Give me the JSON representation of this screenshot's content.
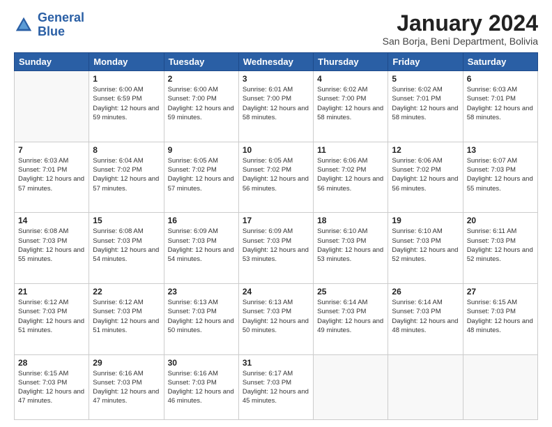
{
  "logo": {
    "line1": "General",
    "line2": "Blue"
  },
  "title": "January 2024",
  "subtitle": "San Borja, Beni Department, Bolivia",
  "weekdays": [
    "Sunday",
    "Monday",
    "Tuesday",
    "Wednesday",
    "Thursday",
    "Friday",
    "Saturday"
  ],
  "weeks": [
    [
      {
        "day": "",
        "sunrise": "",
        "sunset": "",
        "daylight": ""
      },
      {
        "day": "1",
        "sunrise": "Sunrise: 6:00 AM",
        "sunset": "Sunset: 6:59 PM",
        "daylight": "Daylight: 12 hours and 59 minutes."
      },
      {
        "day": "2",
        "sunrise": "Sunrise: 6:00 AM",
        "sunset": "Sunset: 7:00 PM",
        "daylight": "Daylight: 12 hours and 59 minutes."
      },
      {
        "day": "3",
        "sunrise": "Sunrise: 6:01 AM",
        "sunset": "Sunset: 7:00 PM",
        "daylight": "Daylight: 12 hours and 58 minutes."
      },
      {
        "day": "4",
        "sunrise": "Sunrise: 6:02 AM",
        "sunset": "Sunset: 7:00 PM",
        "daylight": "Daylight: 12 hours and 58 minutes."
      },
      {
        "day": "5",
        "sunrise": "Sunrise: 6:02 AM",
        "sunset": "Sunset: 7:01 PM",
        "daylight": "Daylight: 12 hours and 58 minutes."
      },
      {
        "day": "6",
        "sunrise": "Sunrise: 6:03 AM",
        "sunset": "Sunset: 7:01 PM",
        "daylight": "Daylight: 12 hours and 58 minutes."
      }
    ],
    [
      {
        "day": "7",
        "sunrise": "Sunrise: 6:03 AM",
        "sunset": "Sunset: 7:01 PM",
        "daylight": "Daylight: 12 hours and 57 minutes."
      },
      {
        "day": "8",
        "sunrise": "Sunrise: 6:04 AM",
        "sunset": "Sunset: 7:02 PM",
        "daylight": "Daylight: 12 hours and 57 minutes."
      },
      {
        "day": "9",
        "sunrise": "Sunrise: 6:05 AM",
        "sunset": "Sunset: 7:02 PM",
        "daylight": "Daylight: 12 hours and 57 minutes."
      },
      {
        "day": "10",
        "sunrise": "Sunrise: 6:05 AM",
        "sunset": "Sunset: 7:02 PM",
        "daylight": "Daylight: 12 hours and 56 minutes."
      },
      {
        "day": "11",
        "sunrise": "Sunrise: 6:06 AM",
        "sunset": "Sunset: 7:02 PM",
        "daylight": "Daylight: 12 hours and 56 minutes."
      },
      {
        "day": "12",
        "sunrise": "Sunrise: 6:06 AM",
        "sunset": "Sunset: 7:02 PM",
        "daylight": "Daylight: 12 hours and 56 minutes."
      },
      {
        "day": "13",
        "sunrise": "Sunrise: 6:07 AM",
        "sunset": "Sunset: 7:03 PM",
        "daylight": "Daylight: 12 hours and 55 minutes."
      }
    ],
    [
      {
        "day": "14",
        "sunrise": "Sunrise: 6:08 AM",
        "sunset": "Sunset: 7:03 PM",
        "daylight": "Daylight: 12 hours and 55 minutes."
      },
      {
        "day": "15",
        "sunrise": "Sunrise: 6:08 AM",
        "sunset": "Sunset: 7:03 PM",
        "daylight": "Daylight: 12 hours and 54 minutes."
      },
      {
        "day": "16",
        "sunrise": "Sunrise: 6:09 AM",
        "sunset": "Sunset: 7:03 PM",
        "daylight": "Daylight: 12 hours and 54 minutes."
      },
      {
        "day": "17",
        "sunrise": "Sunrise: 6:09 AM",
        "sunset": "Sunset: 7:03 PM",
        "daylight": "Daylight: 12 hours and 53 minutes."
      },
      {
        "day": "18",
        "sunrise": "Sunrise: 6:10 AM",
        "sunset": "Sunset: 7:03 PM",
        "daylight": "Daylight: 12 hours and 53 minutes."
      },
      {
        "day": "19",
        "sunrise": "Sunrise: 6:10 AM",
        "sunset": "Sunset: 7:03 PM",
        "daylight": "Daylight: 12 hours and 52 minutes."
      },
      {
        "day": "20",
        "sunrise": "Sunrise: 6:11 AM",
        "sunset": "Sunset: 7:03 PM",
        "daylight": "Daylight: 12 hours and 52 minutes."
      }
    ],
    [
      {
        "day": "21",
        "sunrise": "Sunrise: 6:12 AM",
        "sunset": "Sunset: 7:03 PM",
        "daylight": "Daylight: 12 hours and 51 minutes."
      },
      {
        "day": "22",
        "sunrise": "Sunrise: 6:12 AM",
        "sunset": "Sunset: 7:03 PM",
        "daylight": "Daylight: 12 hours and 51 minutes."
      },
      {
        "day": "23",
        "sunrise": "Sunrise: 6:13 AM",
        "sunset": "Sunset: 7:03 PM",
        "daylight": "Daylight: 12 hours and 50 minutes."
      },
      {
        "day": "24",
        "sunrise": "Sunrise: 6:13 AM",
        "sunset": "Sunset: 7:03 PM",
        "daylight": "Daylight: 12 hours and 50 minutes."
      },
      {
        "day": "25",
        "sunrise": "Sunrise: 6:14 AM",
        "sunset": "Sunset: 7:03 PM",
        "daylight": "Daylight: 12 hours and 49 minutes."
      },
      {
        "day": "26",
        "sunrise": "Sunrise: 6:14 AM",
        "sunset": "Sunset: 7:03 PM",
        "daylight": "Daylight: 12 hours and 48 minutes."
      },
      {
        "day": "27",
        "sunrise": "Sunrise: 6:15 AM",
        "sunset": "Sunset: 7:03 PM",
        "daylight": "Daylight: 12 hours and 48 minutes."
      }
    ],
    [
      {
        "day": "28",
        "sunrise": "Sunrise: 6:15 AM",
        "sunset": "Sunset: 7:03 PM",
        "daylight": "Daylight: 12 hours and 47 minutes."
      },
      {
        "day": "29",
        "sunrise": "Sunrise: 6:16 AM",
        "sunset": "Sunset: 7:03 PM",
        "daylight": "Daylight: 12 hours and 47 minutes."
      },
      {
        "day": "30",
        "sunrise": "Sunrise: 6:16 AM",
        "sunset": "Sunset: 7:03 PM",
        "daylight": "Daylight: 12 hours and 46 minutes."
      },
      {
        "day": "31",
        "sunrise": "Sunrise: 6:17 AM",
        "sunset": "Sunset: 7:03 PM",
        "daylight": "Daylight: 12 hours and 45 minutes."
      },
      {
        "day": "",
        "sunrise": "",
        "sunset": "",
        "daylight": ""
      },
      {
        "day": "",
        "sunrise": "",
        "sunset": "",
        "daylight": ""
      },
      {
        "day": "",
        "sunrise": "",
        "sunset": "",
        "daylight": ""
      }
    ]
  ]
}
